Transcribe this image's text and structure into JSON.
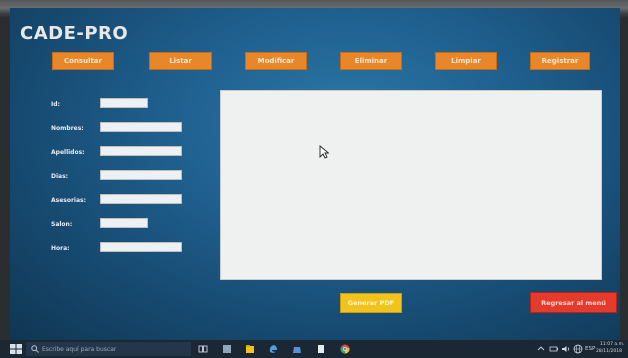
{
  "app": {
    "title": "CADE-PRO"
  },
  "toolbar": {
    "buttons": [
      {
        "label": "Consultar"
      },
      {
        "label": "Listar"
      },
      {
        "label": "Modificar"
      },
      {
        "label": "Eliminar"
      },
      {
        "label": "Limpiar"
      },
      {
        "label": "Registrar"
      }
    ]
  },
  "form": {
    "fields": [
      {
        "label": "Id:",
        "value": ""
      },
      {
        "label": "Nombres:",
        "value": ""
      },
      {
        "label": "Apellidos:",
        "value": ""
      },
      {
        "label": "Dias:",
        "value": ""
      },
      {
        "label": "Asesorias:",
        "value": ""
      },
      {
        "label": "Salon:",
        "value": ""
      },
      {
        "label": "Hora:",
        "value": ""
      }
    ]
  },
  "actions": {
    "pdf_label": "Generar PDF",
    "menu_label": "Regresar al menú"
  },
  "taskbar": {
    "search_placeholder": "Escribe aquí para buscar",
    "tray_lang": "ESP",
    "time": "11:07 a.m.",
    "date": "28/11/2018"
  },
  "colors": {
    "toolbar_button": "#e8862a",
    "pdf_button": "#f2c21d",
    "menu_button": "#e53b2c",
    "background": "#1f5f8e"
  }
}
